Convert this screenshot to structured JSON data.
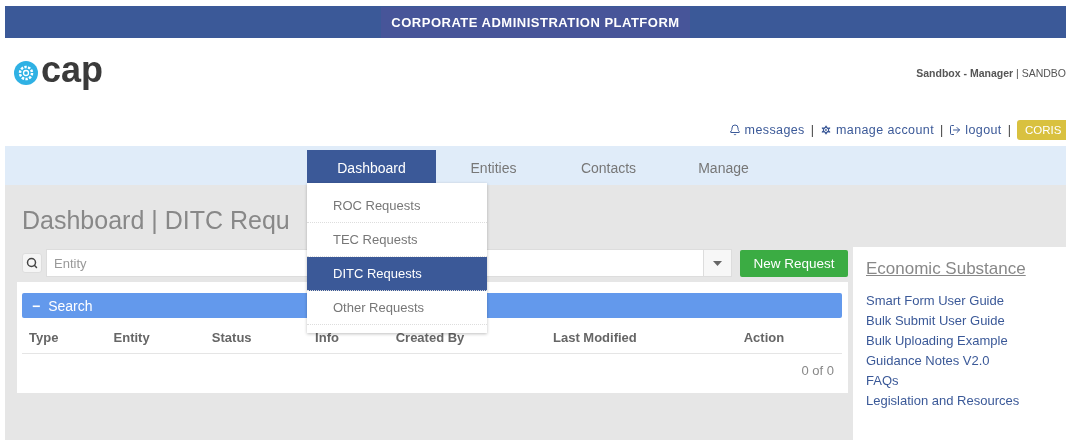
{
  "banner": {
    "title": "CORPORATE ADMINISTRATION PLATFORM"
  },
  "logo": {
    "text": "cap"
  },
  "user": {
    "role": "Sandbox - Manager",
    "separator": "|",
    "account": "SANDBO"
  },
  "account_links": [
    {
      "kind": "messages",
      "label": "messages"
    },
    {
      "kind": "settings",
      "label": "manage account"
    },
    {
      "kind": "logout",
      "label": "logout"
    }
  ],
  "link_separator": "|",
  "coris_button": "CORIS",
  "nav": [
    {
      "label": "Dashboard",
      "selected": true
    },
    {
      "label": "Entities",
      "selected": false
    },
    {
      "label": "Contacts",
      "selected": false
    },
    {
      "label": "Manage",
      "selected": false
    }
  ],
  "dropdown": [
    {
      "label": "ROC Requests",
      "selected": false
    },
    {
      "label": "TEC Requests",
      "selected": false
    },
    {
      "label": "DITC Requests",
      "selected": true
    },
    {
      "label": "Other Requests",
      "selected": false
    }
  ],
  "page_title": "Dashboard | DITC Requ",
  "entity_field": {
    "placeholder": "Entity"
  },
  "new_request_button": "New Request",
  "search_panel": {
    "toggle": "−",
    "label": "Search",
    "expanded": true
  },
  "table": {
    "columns": [
      "Type",
      "Entity",
      "Status",
      "Info",
      "Created By",
      "Last Modified",
      "Action"
    ],
    "pager": "0 of 0"
  },
  "sidebar": {
    "title": "Economic Substance",
    "links": [
      "Smart Form User Guide",
      "Bulk Submit User Guide",
      "Bulk Uploading Example",
      "Guidance Notes V2.0",
      "FAQs",
      "Legislation and Resources"
    ]
  }
}
